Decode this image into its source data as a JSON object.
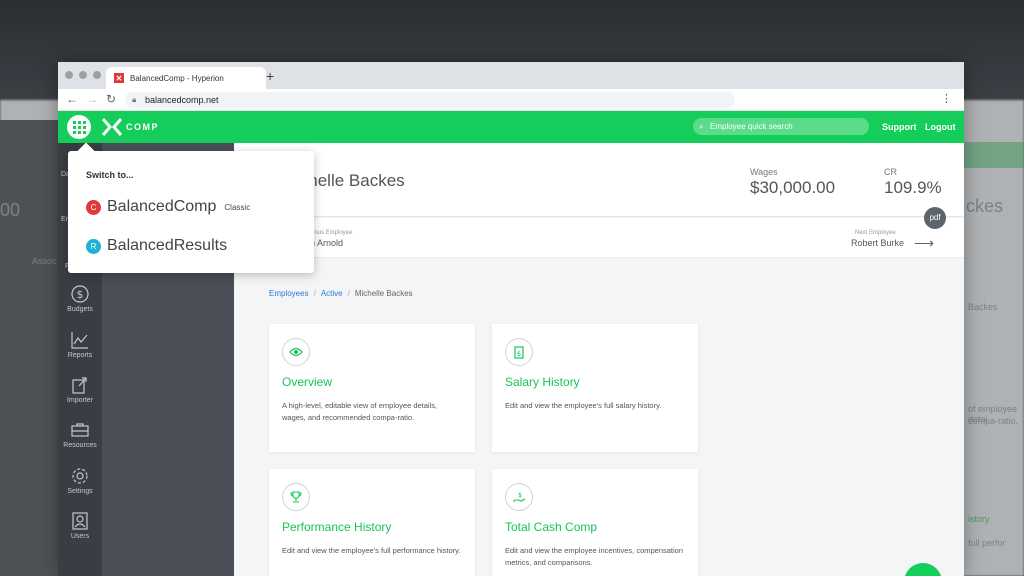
{
  "browser": {
    "tab_title": "BalancedComp - Hyperion",
    "new_tab": "+",
    "url": "balancedcomp.net"
  },
  "app": {
    "logo_text": "COMP",
    "search_placeholder": "Employee quick search",
    "support_label": "Support",
    "logout_label": "Logout"
  },
  "sidebar": {
    "items": [
      {
        "label": "Budgets",
        "icon": "dollar-icon"
      },
      {
        "label": "Reports",
        "icon": "chart-icon"
      },
      {
        "label": "Importer",
        "icon": "import-icon"
      },
      {
        "label": "Resources",
        "icon": "toolbox-icon"
      },
      {
        "label": "Settings",
        "icon": "gear-icon"
      },
      {
        "label": "Users",
        "icon": "users-icon"
      }
    ],
    "partial_labels": [
      "Da",
      "En",
      "F"
    ]
  },
  "switcher": {
    "title": "Switch to...",
    "items": [
      {
        "badge": "C",
        "name": "BalancedComp",
        "tag": "Classic",
        "color": "#e03a3e"
      },
      {
        "badge": "R",
        "name": "BalancedResults",
        "tag": "",
        "color": "#1fb0d6"
      }
    ]
  },
  "employee": {
    "name": "Michelle Backes",
    "name_visible": "ichelle Backes",
    "wages_label": "Wages",
    "wages_value": "$30,000.00",
    "cr_label": "CR",
    "cr_value": "109.9%",
    "pdf_label": "pdf",
    "previous_label": "vious Employee",
    "previous_name": "n Arnold",
    "next_label": "Next Employee",
    "next_name": "Robert Burke"
  },
  "breadcrumb": {
    "items": [
      "Employees",
      "Active",
      "Michelle Backes"
    ]
  },
  "cards": [
    {
      "title": "Overview",
      "desc": "A high-level, editable view of employee details, wages, and recommended compa-ratio.",
      "icon": "eye-icon"
    },
    {
      "title": "Salary History",
      "desc": "Edit and view the employee's full salary history.",
      "icon": "document-dollar-icon"
    },
    {
      "title": "Performance History",
      "desc": "Edit and view the employee's full performance history.",
      "icon": "trophy-icon"
    },
    {
      "title": "Total Cash Comp",
      "desc": "Edit and view the employee incentives, compensation metrics, and comparisons.",
      "icon": "hand-money-icon"
    }
  ],
  "backdrop": {
    "left_number": "00",
    "right_name": "ckes",
    "right_small_1": "Backes",
    "right_small_2": "of employee detai",
    "right_small_3": "compa-ratio.",
    "right_small_4": "istory",
    "right_small_5": "full perfor",
    "left_small": "Assoc"
  },
  "colors": {
    "brand_green": "#15cd5a",
    "sidebar_dark": "#3a3d44",
    "link_blue": "#2a7bd6"
  }
}
